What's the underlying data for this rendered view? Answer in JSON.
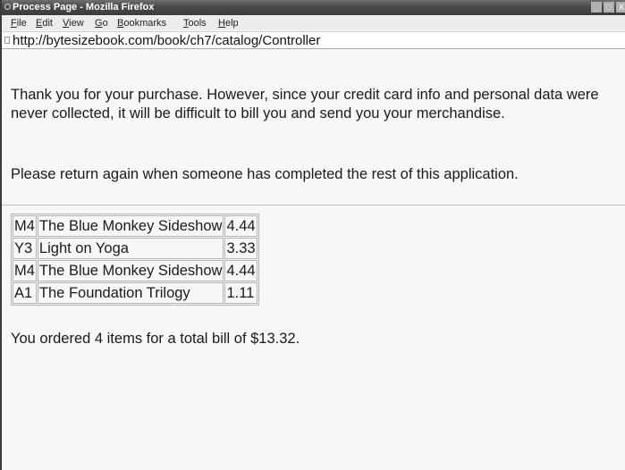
{
  "window": {
    "title": "Process Page - Mozilla Firefox",
    "controls": [
      "_",
      "□",
      "X"
    ]
  },
  "menubar": {
    "items": [
      "File",
      "Edit",
      "View",
      "Go",
      "Bookmarks",
      "Tools",
      "Help"
    ]
  },
  "address": {
    "url": "http://bytesizebook.com/book/ch7/catalog/Controller"
  },
  "content": {
    "message_1": "Thank you for your purchase. However, since your credit card info and personal data were never collected, it will be difficult to bill you and send you your merchandise.",
    "message_2": "Please return again when someone has completed the rest of this application.",
    "items": [
      {
        "code": "M4",
        "title": "The Blue Monkey Sideshow",
        "price": "4.44"
      },
      {
        "code": "Y3",
        "title": "Light on Yoga",
        "price": "3.33"
      },
      {
        "code": "M4",
        "title": "The Blue Monkey Sideshow",
        "price": "4.44"
      },
      {
        "code": "A1",
        "title": "The Foundation Trilogy",
        "price": "1.11"
      }
    ],
    "total_message": "You ordered 4 items for a total bill of $13.32."
  }
}
